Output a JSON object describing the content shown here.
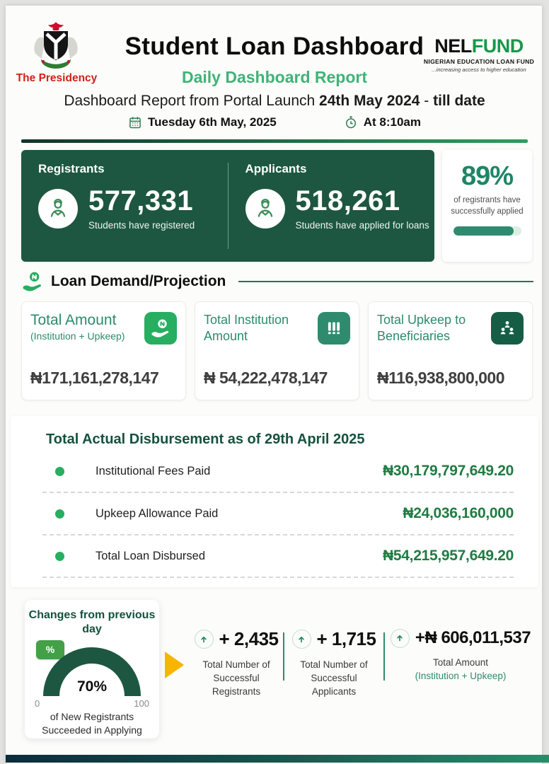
{
  "header": {
    "presidency": "The Presidency",
    "title": "Student Loan Dashboard",
    "subtitle": "Daily Dashboard Report",
    "logo": {
      "nel": "NEL",
      "fund": "FUND",
      "org": "NIGERIAN EDUCATION LOAN FUND",
      "tagline": "...increasing access to higher education"
    },
    "report_prefix": "Dashboard Report from Portal Launch",
    "report_bold": "24th May 2024",
    "report_sep": " - ",
    "report_suffix": "till date",
    "date": "Tuesday 6th May, 2025",
    "time": "At 8:10am"
  },
  "summary": {
    "registrants": {
      "label": "Registrants",
      "value": "577,331",
      "caption": "Students have registered"
    },
    "applicants": {
      "label": "Applicants",
      "value": "518,261",
      "caption": "Students have applied for loans"
    },
    "applied_rate": {
      "value": "89%",
      "percent": 89,
      "caption": "of registrants have successfully applied"
    }
  },
  "loan_demand": {
    "section_title": "Loan Demand/Projection",
    "cards": [
      {
        "title": "Total Amount",
        "subtitle": "(Institution + Upkeep)",
        "value": "₦171,161,278,147",
        "icon": "hand-coin-icon"
      },
      {
        "title": "Total Institution Amount",
        "value": "₦ 54,222,478,147",
        "icon": "columns-icon"
      },
      {
        "title": "Total Upkeep to Beneficiaries",
        "value": "₦116,938,800,000",
        "icon": "group-icon"
      }
    ]
  },
  "disbursement": {
    "title": "Total Actual Disbursement as of 29th April 2025",
    "rows": [
      {
        "label": "Institutional Fees Paid",
        "value": "₦30,179,797,649.20"
      },
      {
        "label": "Upkeep Allowance Paid",
        "value": "₦24,036,160,000"
      },
      {
        "label": "Total Loan Disbursed",
        "value": "₦54,215,957,649.20"
      }
    ]
  },
  "changes": {
    "title": "Changes from previous day",
    "badge": "%",
    "gauge": {
      "value": "70%",
      "min": "0",
      "max": "100",
      "caption_line1": "of New Registrants",
      "caption_line2": "Succeeded in Applying"
    },
    "stats": [
      {
        "value": "+ 2,435",
        "caption": "Total Number of Successful Registrants"
      },
      {
        "value": "+ 1,715",
        "caption": "Total Number of Successful Applicants"
      },
      {
        "value": "+₦ 606,011,537",
        "caption": "Total Amount",
        "caption2": "(Institution + Upkeep)"
      }
    ]
  },
  "colors": {
    "panel_green": "#1d5741",
    "brand_green": "#18984a",
    "teal_accent": "#2e8b6e",
    "value_green": "#1e7c41",
    "presidency_red": "#cf2217",
    "arrow_yellow": "#f7b500",
    "badge_green": "#43a047"
  },
  "chart_data": [
    {
      "type": "gauge",
      "title": "Changes from previous day",
      "value": 70,
      "min": 0,
      "max": 100,
      "label": "70%",
      "caption": "of New Registrants Succeeded in Applying"
    },
    {
      "type": "progress",
      "title": "Registrants successfully applied",
      "value": 89,
      "max": 100,
      "label": "89%"
    },
    {
      "type": "table",
      "title": "Total Actual Disbursement as of 29th April 2025",
      "rows": [
        [
          "Institutional Fees Paid",
          "₦30,179,797,649.20"
        ],
        [
          "Upkeep Allowance Paid",
          "₦24,036,160,000"
        ],
        [
          "Total Loan Disbursed",
          "₦54,215,957,649.20"
        ]
      ]
    },
    {
      "type": "table",
      "title": "Daily changes from previous day",
      "rows": [
        [
          "Total Number of Successful Registrants",
          "+2,435"
        ],
        [
          "Total Number of Successful Applicants",
          "+1,715"
        ],
        [
          "Total Amount (Institution + Upkeep)",
          "+₦606,011,537"
        ]
      ]
    }
  ]
}
